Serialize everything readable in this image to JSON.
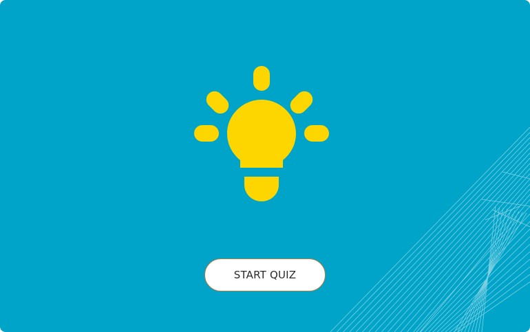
{
  "colors": {
    "background": "#00a4c8",
    "accent": "#fdd600",
    "line_art": "#8fd6e7",
    "button_background": "#ffffff",
    "button_border": "#b47a3c",
    "button_text": "#2a2a2a"
  },
  "hero": {
    "icon": "lightbulb-icon"
  },
  "quiz": {
    "start_label": "START QUIZ"
  }
}
